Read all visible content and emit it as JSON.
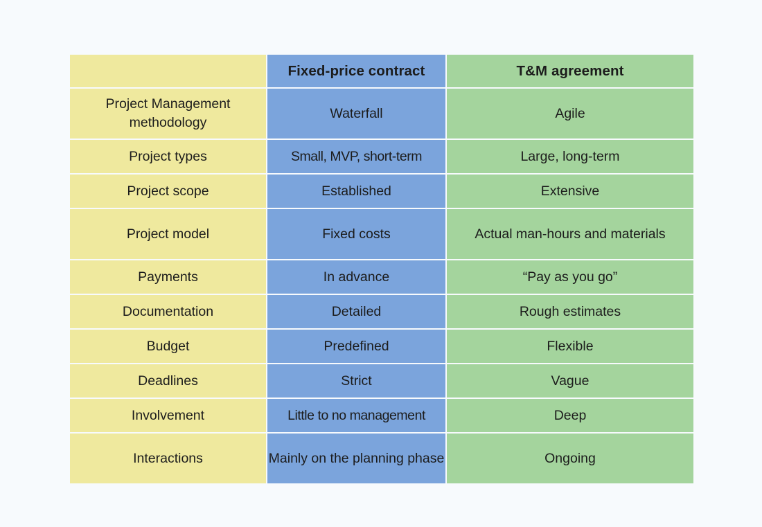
{
  "table": {
    "columns": [
      {
        "key": "label",
        "header": ""
      },
      {
        "key": "fixed",
        "header": "Fixed-price contract"
      },
      {
        "key": "tm",
        "header": "T&M agreement"
      }
    ],
    "rows": [
      {
        "label": "Project Management methodology",
        "fixed": "Waterfall",
        "tm": "Agile"
      },
      {
        "label": "Project types",
        "fixed": "Small, MVP, short-term",
        "tm": "Large, long-term"
      },
      {
        "label": "Project scope",
        "fixed": "Established",
        "tm": "Extensive"
      },
      {
        "label": "Project model",
        "fixed": "Fixed costs",
        "tm": "Actual man-hours and materials"
      },
      {
        "label": "Payments",
        "fixed": "In advance",
        "tm": "“Pay as you go”"
      },
      {
        "label": "Documentation",
        "fixed": "Detailed",
        "tm": "Rough estimates"
      },
      {
        "label": "Budget",
        "fixed": "Predefined",
        "tm": "Flexible"
      },
      {
        "label": "Deadlines",
        "fixed": "Strict",
        "tm": "Vague"
      },
      {
        "label": "Involvement",
        "fixed": "Little to no management",
        "tm": "Deep"
      },
      {
        "label": "Interactions",
        "fixed": "Mainly on the planning phase",
        "tm": "Ongoing"
      }
    ]
  },
  "colors": {
    "page_background": "#f7fafd",
    "label_column": "#efe99e",
    "fixed_price_column": "#7ba4dc",
    "tm_column": "#a4d49d",
    "text": "#1c1c1c",
    "grid_line": "#ffffff"
  }
}
